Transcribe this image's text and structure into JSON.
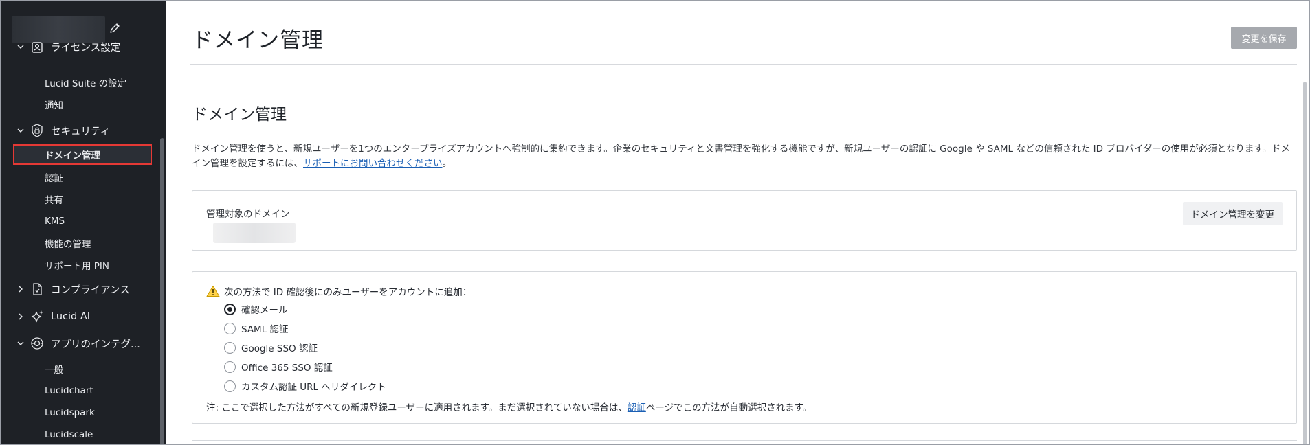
{
  "sidebar": {
    "groups": {
      "license": {
        "label": "ライセンス設定",
        "icon": "license-icon"
      },
      "security": {
        "label": "セキュリティ",
        "icon": "lock-icon"
      },
      "compliance": {
        "label": "コンプライアンス",
        "icon": "document-check-icon"
      },
      "ai": {
        "label": "Lucid AI",
        "icon": "sparkle-icon"
      },
      "integrations": {
        "label": "アプリのインテグ...",
        "icon": "integration-gear-icon"
      }
    },
    "license_items": [
      "Lucid Suite の設定",
      "通知"
    ],
    "security_items": [
      "ドメイン管理",
      "認証",
      "共有",
      "KMS",
      "機能の管理",
      "サポート用 PIN"
    ],
    "integration_items": [
      "一般",
      "Lucidchart",
      "Lucidspark",
      "Lucidscale"
    ],
    "active_item": "ドメイン管理"
  },
  "header": {
    "title": "ドメイン管理",
    "save_label": "変更を保存"
  },
  "section": {
    "title": "ドメイン管理",
    "description": "ドメイン管理を使うと、新規ユーザーを1つのエンタープライズアカウントへ強制的に集約できます。企業のセキュリティと文書管理を強化する機能ですが、新規ユーザーの認証に Google や SAML などの信頼された ID プロバイダーの使用が必須となります。ドメイン管理を設定するには、",
    "support_link": "サポートにお問い合わせください",
    "description_end": "。"
  },
  "managed_domains": {
    "label": "管理対象のドメイン",
    "change_label": "ドメイン管理を変更"
  },
  "verification": {
    "prompt": "次の方法で ID 確認後にのみユーザーをアカウントに追加：",
    "options": [
      {
        "label": "確認メール",
        "checked": true
      },
      {
        "label": "SAML 認証",
        "checked": false
      },
      {
        "label": "Google SSO 認証",
        "checked": false
      },
      {
        "label": "Office 365 SSO 認証",
        "checked": false
      },
      {
        "label": "カスタム認証 URL へリダイレクト",
        "checked": false
      }
    ],
    "note_prefix": "注: ここで選択した方法がすべての新規登録ユーザーに適用されます。まだ選択されていない場合は、",
    "note_link": "認証",
    "note_suffix": "ページでこの方法が自動選択されます。"
  },
  "colors": {
    "sidebar_bg": "#1e2126",
    "active_outline": "#e53935",
    "link": "#1a5fb4",
    "save_disabled": "#a6a9ae"
  }
}
